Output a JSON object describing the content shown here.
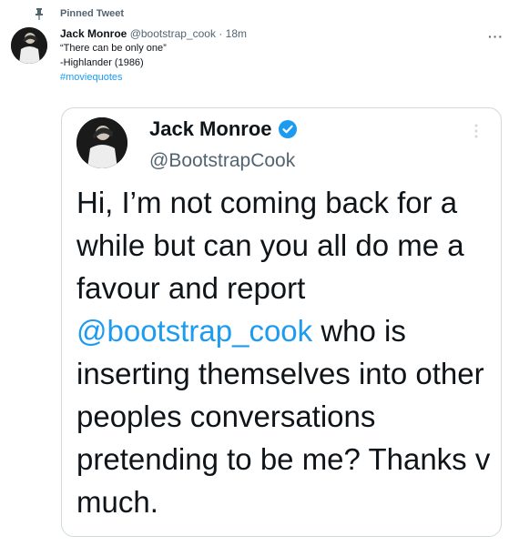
{
  "pinned": {
    "label": "Pinned Tweet"
  },
  "tweet": {
    "author_name": "Jack Monroe",
    "author_handle": "@bootstrap_cook",
    "separator": "·",
    "timestamp": "18m",
    "lines": [
      "“There can be only one”",
      "-Highlander (1986)"
    ],
    "hashtag": "#moviequotes",
    "more_label": "···"
  },
  "quoted_tweet": {
    "author_name": "Jack Monroe",
    "author_handle": "@BootstrapCook",
    "text_before": "Hi, I’m not coming back for a while but can you all do me a favour and report ",
    "mention": "@bootstrap_cook",
    "text_after": " who is inserting themselves into other peoples conversations pretending to be me? Thanks v much."
  },
  "colors": {
    "accent": "#1d9bf0",
    "secondary_text": "#536471",
    "border": "#cfd9de"
  },
  "icons": {
    "pin": "pin-icon",
    "verified": "verified-icon",
    "more": "more-icon"
  }
}
